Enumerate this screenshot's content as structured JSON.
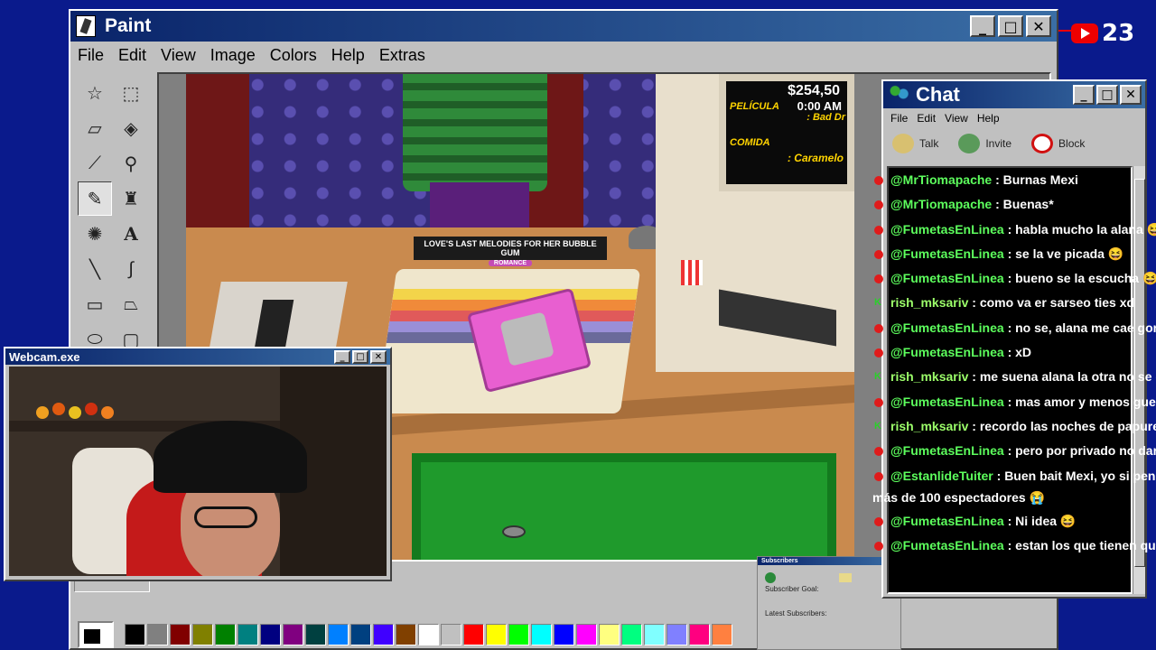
{
  "paint": {
    "title": "Paint",
    "menu": [
      "File",
      "Edit",
      "View",
      "Image",
      "Colors",
      "Help",
      "Extras"
    ],
    "tools": [
      "free-select",
      "rect-select",
      "eraser",
      "fill",
      "color-picker",
      "magnifier",
      "pencil",
      "brush",
      "airbrush",
      "text",
      "line",
      "curve",
      "rectangle",
      "polygon",
      "ellipse",
      "rounded-rectangle"
    ],
    "palette": [
      "#000000",
      "#808080",
      "#800000",
      "#808000",
      "#008000",
      "#008080",
      "#000080",
      "#800080",
      "#004040",
      "#0080ff",
      "#004080",
      "#4000ff",
      "#804000",
      "#ffffff",
      "#c0c0c0",
      "#ff0000",
      "#ffff00",
      "#00ff00",
      "#00ffff",
      "#0000ff",
      "#ff00ff",
      "#ffff80",
      "#00ff80",
      "#80ffff",
      "#8080ff",
      "#ff0080",
      "#ff8040"
    ]
  },
  "game": {
    "item_title": "LOVE'S LAST MELODIES FOR HER BUBBLE GUM",
    "item_genre": "ROMANCE",
    "money": "$254,50",
    "label_movie": "PELÍCULA",
    "time": "0:00 AM",
    "movie_name": ": Bad Dr",
    "label_food": "COMIDA",
    "food_name": ": Caramelo"
  },
  "webcam": {
    "title": "Webcam.exe"
  },
  "subscribers": {
    "title": "Subscribers",
    "goal_label": "Subscriber Goal:",
    "latest_label": "Latest Subscribers:"
  },
  "chat": {
    "title": "Chat",
    "menu": [
      "File",
      "Edit",
      "View",
      "Help"
    ],
    "actions": {
      "talk": "Talk",
      "invite": "Invite",
      "block": "Block"
    },
    "messages": [
      {
        "platform": "yt",
        "user": "@MrTiomapache",
        "text": " : Burnas Mexi"
      },
      {
        "platform": "yt",
        "user": "@MrTiomapache",
        "text": " : Buenas*"
      },
      {
        "platform": "yt",
        "user": "@FumetasEnLinea",
        "text": " : habla mucho la alana 😆"
      },
      {
        "platform": "yt",
        "user": "@FumetasEnLinea",
        "text": " : se la ve picada 😆"
      },
      {
        "platform": "yt",
        "user": "@FumetasEnLinea",
        "text": " : bueno se la escucha 😆"
      },
      {
        "platform": "kick",
        "user": "rish_mksariv",
        "text": " : como va er sarseo ties xd"
      },
      {
        "platform": "yt",
        "user": "@FumetasEnLinea",
        "text": " : no se, alana me cae gor"
      },
      {
        "platform": "yt",
        "user": "@FumetasEnLinea",
        "text": " : xD"
      },
      {
        "platform": "kick",
        "user": "rish_mksariv",
        "text": " : me suena alana la otra no se e"
      },
      {
        "platform": "yt",
        "user": "@FumetasEnLinea",
        "text": " : mas amor y menos gue"
      },
      {
        "platform": "kick",
        "user": "rish_mksariv",
        "text": " : recordo las noches de papure"
      },
      {
        "platform": "yt",
        "user": "@FumetasEnLinea",
        "text": " : pero por privado no dar"
      },
      {
        "platform": "yt",
        "user": "@EstanlideTuiter",
        "text": " : Buen bait Mexi, yo si pen",
        "continuation": "más de 100 espectadores 😭"
      },
      {
        "platform": "yt",
        "user": "@FumetasEnLinea",
        "text": " : Ni idea 😆"
      },
      {
        "platform": "yt",
        "user": "@FumetasEnLinea",
        "text": " : estan los que tienen qu"
      }
    ]
  },
  "youtube": {
    "viewer_count": "23"
  }
}
